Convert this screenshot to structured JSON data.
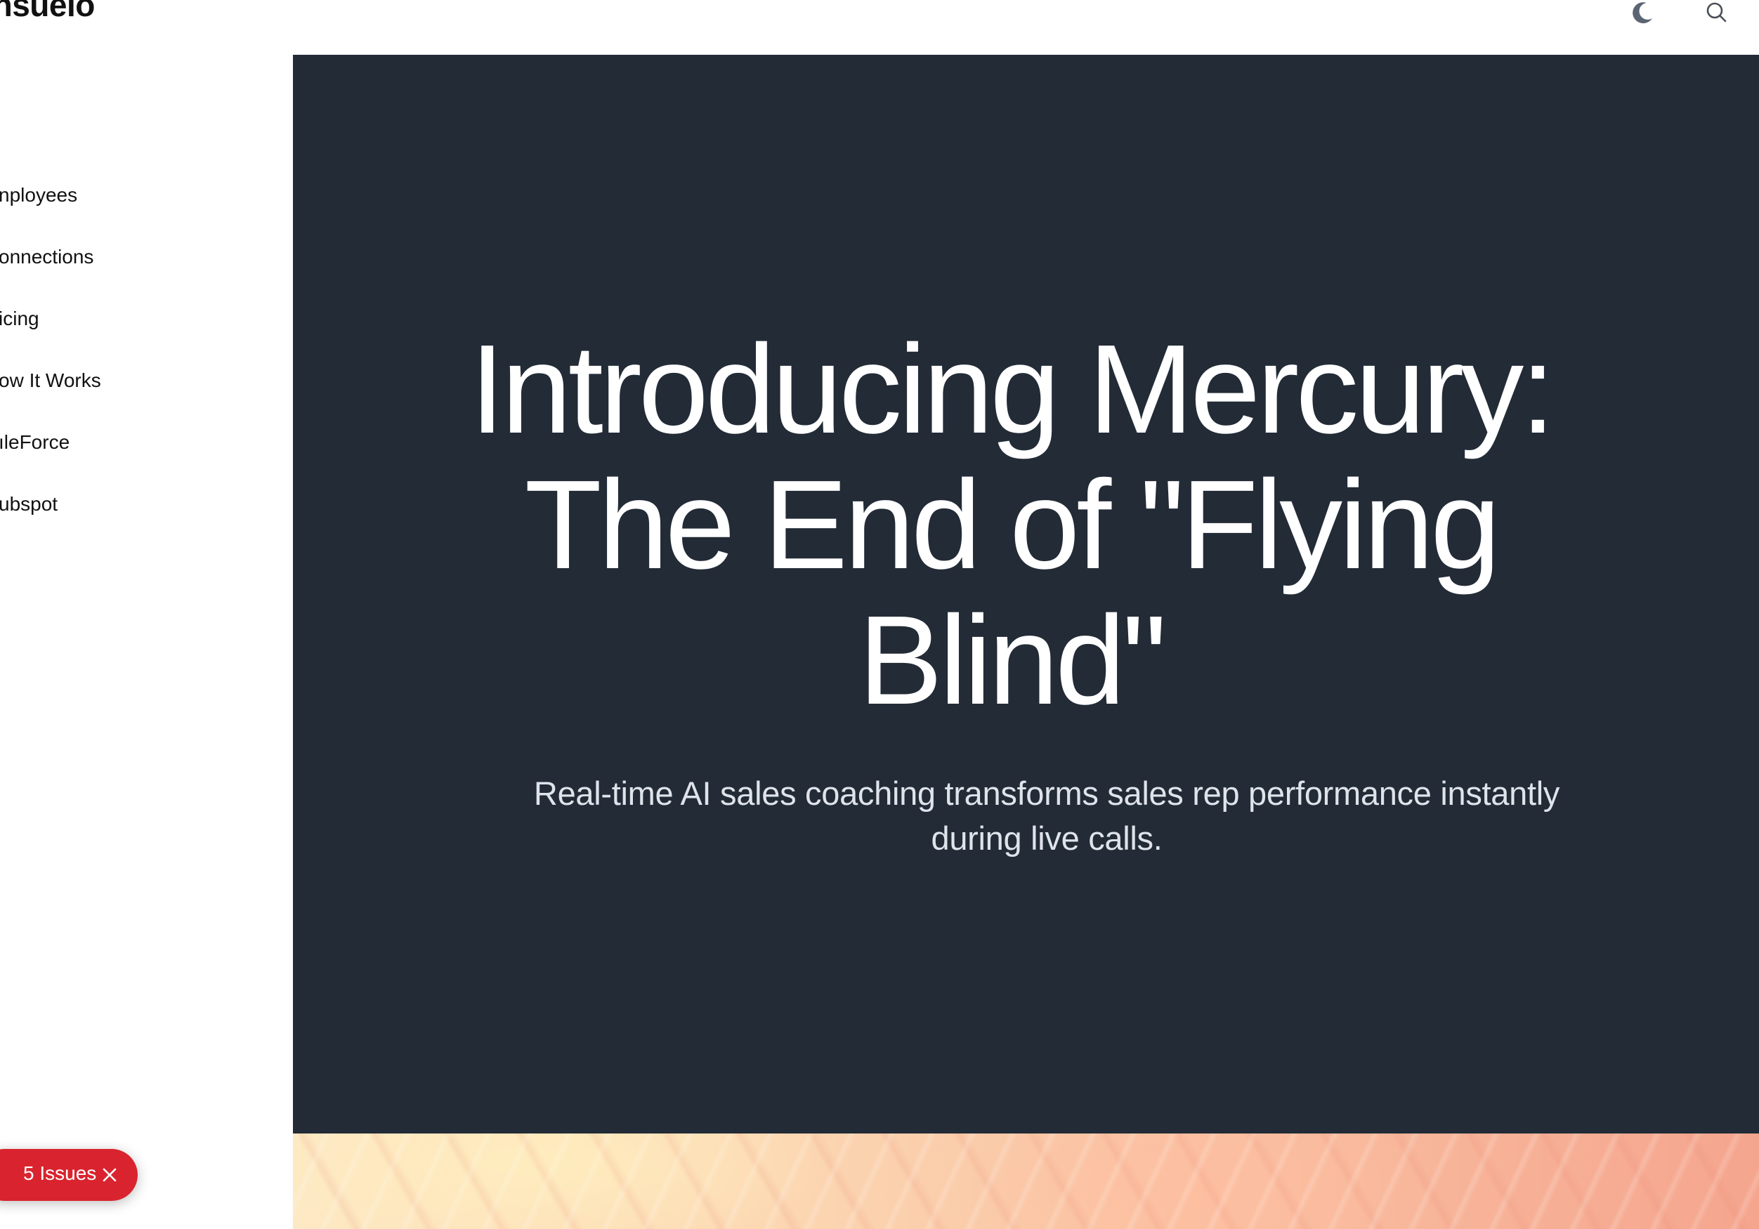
{
  "header": {
    "brand": "onsuelo",
    "theme_toggle_icon": "moon-icon",
    "search_icon": "search-icon"
  },
  "sidebar": {
    "items": [
      {
        "label": "nployees"
      },
      {
        "label": "onnections"
      },
      {
        "label": "icing"
      },
      {
        "label": "ow It Works"
      },
      {
        "label": "ıleForce"
      },
      {
        "label": "ubspot"
      }
    ]
  },
  "hero": {
    "title_line1": "Introducing Mercury:",
    "title_line2": "The End of \"Flying",
    "title_line3": "Blind\"",
    "subtitle_line1": "Real-time AI sales coaching transforms sales rep performance instantly",
    "subtitle_line2": "during live calls.",
    "background_color": "#222b36"
  },
  "issues_badge": {
    "label": "5 Issues",
    "close_icon": "close-icon",
    "color": "#d9242f"
  }
}
